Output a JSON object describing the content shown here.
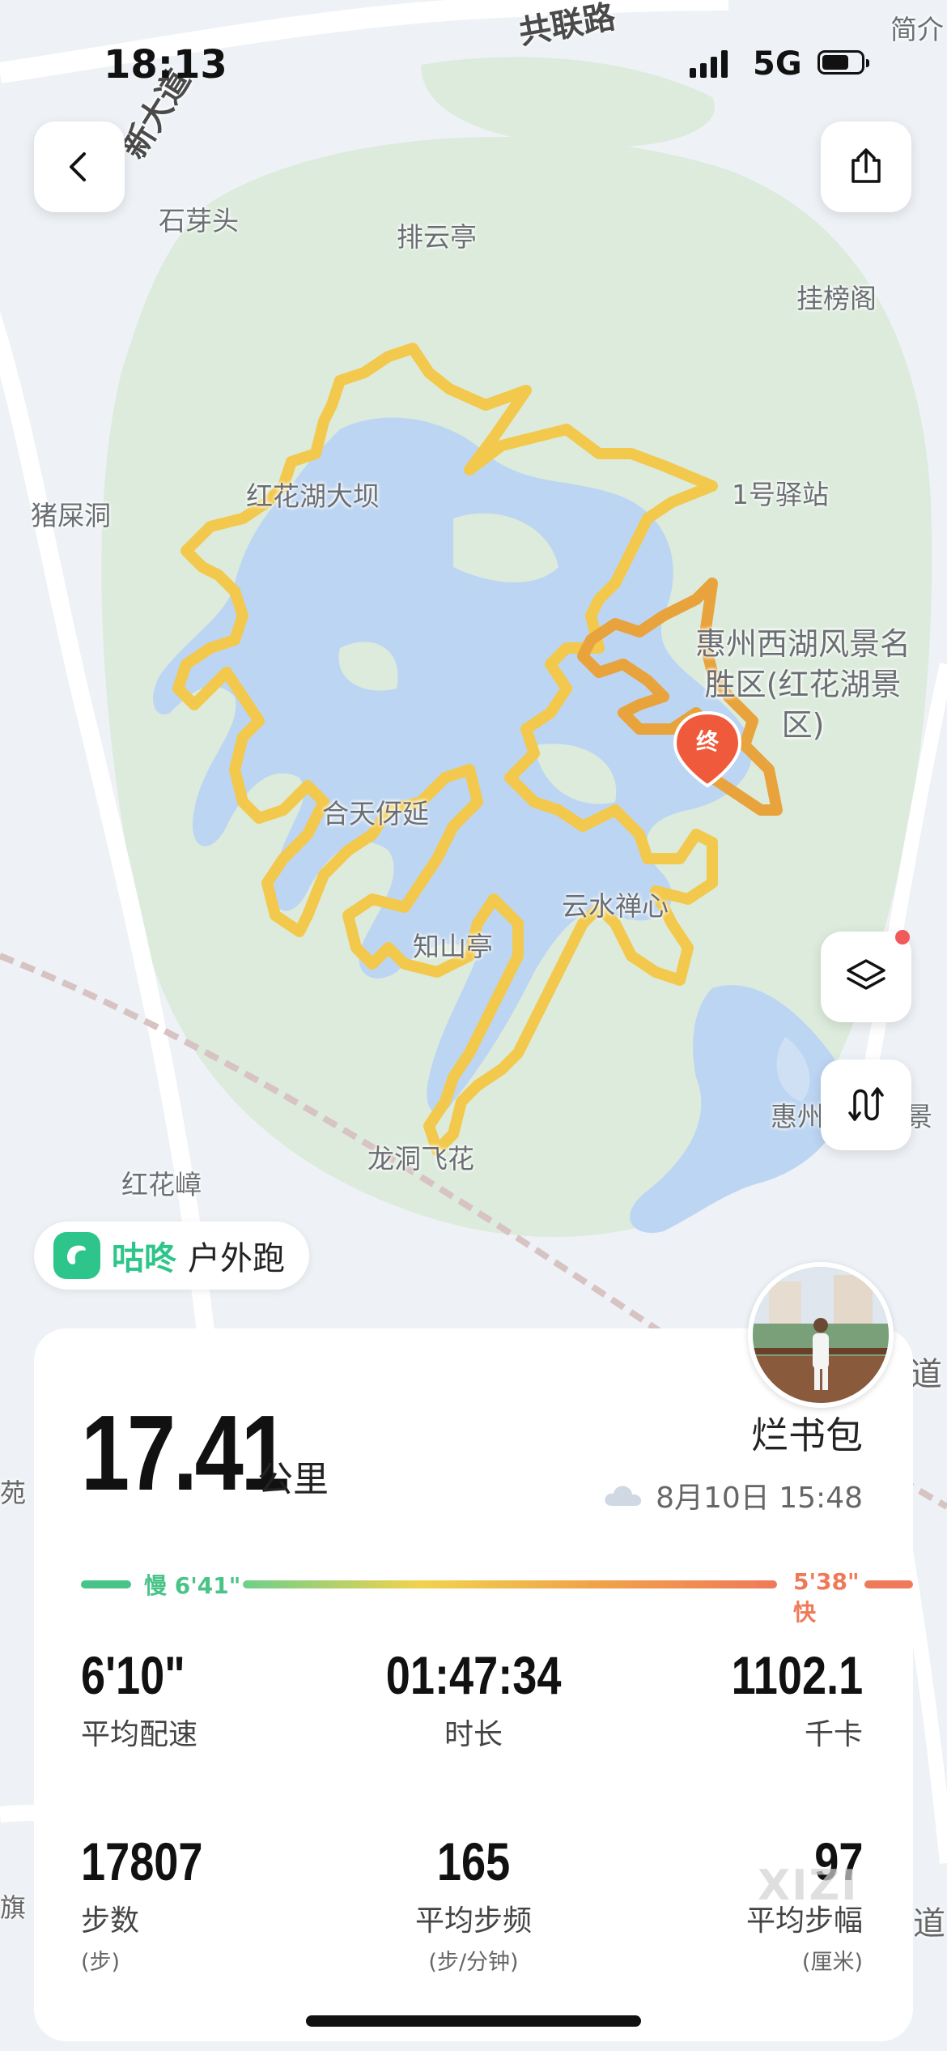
{
  "status_bar": {
    "time": "18:13",
    "network": "5G"
  },
  "map": {
    "labels": {
      "shiyatou": "石芽头",
      "paiyunting": "排云亭",
      "guabangge": "挂榜阁",
      "hongkuahudaba": "红花湖大坝",
      "zhushidong": "猪屎洞",
      "yihaoyizhan": "1号驿站",
      "scenic_area": "惠州西湖风景名胜区(红花湖景区)",
      "hetianyanting": "合天伢延",
      "zhishanting": "知山亭",
      "yunshuichanxin": "云水禅心",
      "longdongfeihua": "龙洞飞花",
      "hongkuazhang": "红花嶂",
      "huizhou_partial": "惠州",
      "yuanjing_partial": "原景",
      "jianying_partial": "简介"
    },
    "roads": {
      "gonglian": "共联路",
      "xin_dadao": "新大道",
      "dao_right": "道",
      "dao_right2": "道",
      "yuan_left": "苑",
      "qi_left": "旗"
    },
    "end_marker": "终",
    "colors": {
      "route_slow": "#f2c94c",
      "route_fast": "#e8a33c",
      "water": "#bcd5f2",
      "park": "#dcebdc",
      "marker": "#ef5a3c"
    }
  },
  "controls": {
    "back_icon": "chevron-left-icon",
    "share_icon": "share-icon",
    "layers_icon": "layers-icon",
    "route_icon": "route-toggle-icon"
  },
  "brand": {
    "name": "咕咚",
    "activity": "户外跑"
  },
  "summary": {
    "distance": "17.41",
    "distance_unit": "公里",
    "user": "烂书包",
    "weather_icon": "cloud-icon",
    "datetime": "8月10日 15:48"
  },
  "pace_legend": {
    "slow": "慢 6'41\"",
    "fast": "5'38\" 快"
  },
  "stats": [
    {
      "value": "6'10\"",
      "label": "平均配速"
    },
    {
      "value": "01:47:34",
      "label": "时长"
    },
    {
      "value": "1102.1",
      "label": "千卡"
    },
    {
      "value": "17807",
      "label": "步数",
      "unit": "(步)"
    },
    {
      "value": "165",
      "label": "平均步频",
      "unit": "(步/分钟)"
    },
    {
      "value": "97",
      "label": "平均步幅",
      "unit": "(厘米)"
    }
  ],
  "watermark": "XIZI"
}
